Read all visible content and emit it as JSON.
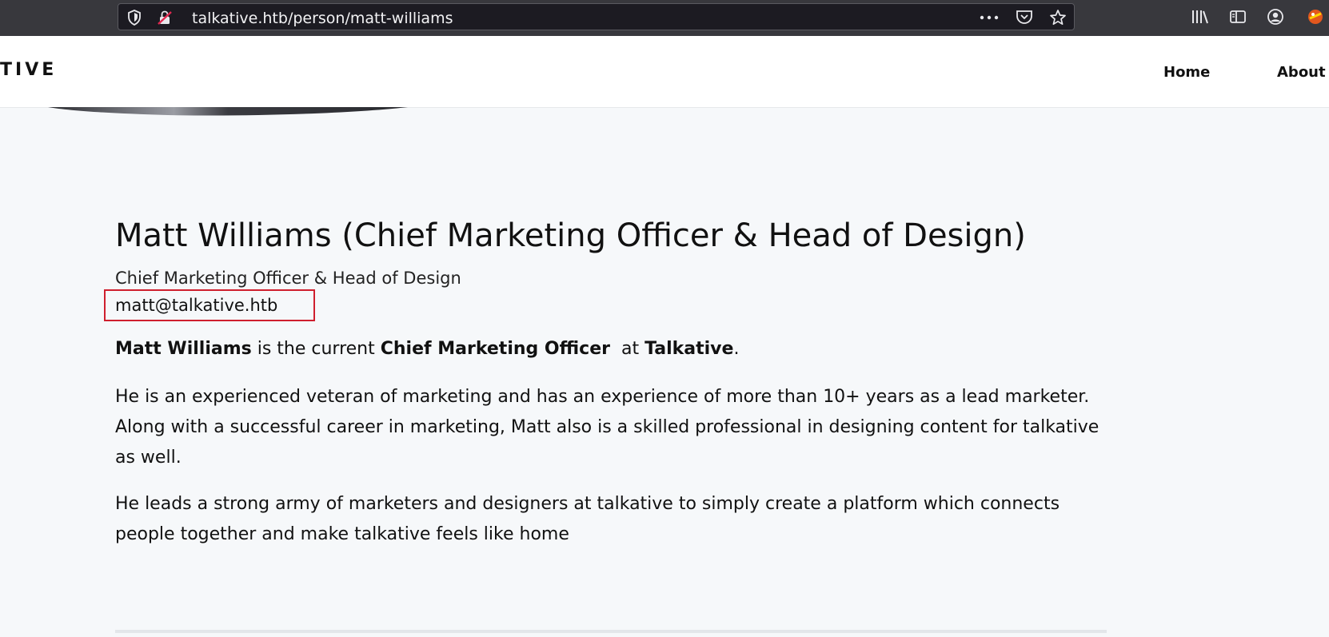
{
  "browser": {
    "url": "talkative.htb/person/matt-williams",
    "icons": [
      "shield-icon",
      "insecure-lock-icon",
      "more-icon",
      "pocket-icon",
      "star-icon",
      "library-icon",
      "sidebar-icon",
      "account-icon",
      "extension-icon"
    ]
  },
  "header": {
    "logo": "TIVE",
    "nav": {
      "home": "Home",
      "about": "About"
    }
  },
  "person": {
    "title": "Matt Williams (Chief Marketing Officer & Head of Design)",
    "subtitle": "Chief Marketing Officer & Head of Design",
    "email": "matt@talkative.htb",
    "intro": {
      "name": "Matt Williams",
      "text1": " is the current ",
      "role": "Chief Marketing Officer",
      "text2": "  at ",
      "company": "Talkative",
      "text3": "."
    },
    "paragraph2": "He is an experienced veteran of marketing and has an experience of more than 10+ years as a lead marketer. Along with a successful career in marketing, Matt also is a skilled professional in designing content for talkative as well.",
    "paragraph3": "He leads a strong army of marketers and designers at talkative to simply create a platform which connects people together and make talkative feels like home"
  },
  "colors": {
    "highlight_border": "#cf1f2e",
    "page_background": "#f6f8fa",
    "browser_toolbar": "#38383d"
  }
}
